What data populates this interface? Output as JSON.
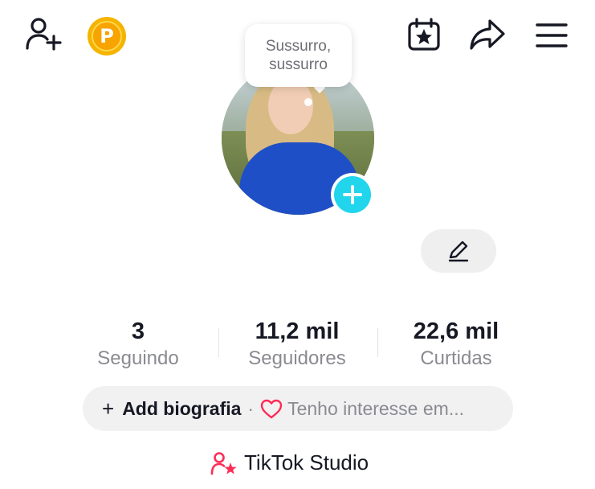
{
  "header": {
    "add_friend_icon": "person-plus-icon",
    "points_badge_label": "P",
    "calendar_icon": "calendar-star-icon",
    "share_icon": "share-arrow-icon",
    "menu_icon": "hamburger-menu-icon"
  },
  "profile": {
    "bubble_text": "Sussurro, sussurro",
    "avatar_icon": "profile-photo",
    "add_avatar_icon": "plus-icon",
    "edit_icon": "pencil-icon"
  },
  "stats": [
    {
      "value": "3",
      "label": "Seguindo"
    },
    {
      "value": "11,2 mil",
      "label": "Seguidores"
    },
    {
      "value": "22,6 mil",
      "label": "Curtidas"
    }
  ],
  "bio": {
    "plus": "+",
    "add_label": "Add biografia",
    "separator": "·",
    "interest_text": "Tenho interesse em...",
    "heart_color": "#fe2c55"
  },
  "studio": {
    "label": "TikTok Studio",
    "icon_color": "#fe2c55"
  }
}
